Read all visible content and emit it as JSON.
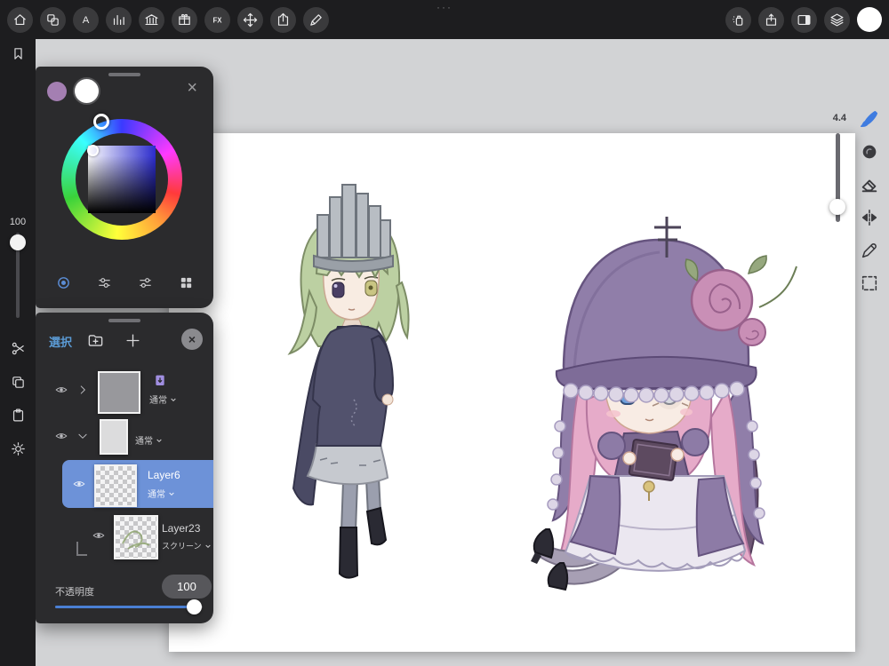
{
  "topbar": {
    "dots": "···",
    "text_tool_label": "A",
    "fx_label": "FX"
  },
  "left_rail": {
    "value": "100"
  },
  "right_rail": {
    "brush_size": "4.4"
  },
  "color_panel": {
    "close_label": "×"
  },
  "layers_panel": {
    "select_label": "選択",
    "close_label": "×",
    "rows": [
      {
        "name": "",
        "blend": "通常"
      },
      {
        "name": "",
        "blend": "通常"
      },
      {
        "name": "Layer6",
        "blend": "通常"
      },
      {
        "name": "Layer23",
        "blend": "スクリーン"
      }
    ],
    "opacity_label": "不透明度",
    "opacity_value": "100"
  },
  "colors": {
    "accent": "#4a7fd4",
    "selected_layer": "#6d92d8",
    "secondary_swatch": "#a47fb2",
    "current_color": "#ffffff"
  }
}
